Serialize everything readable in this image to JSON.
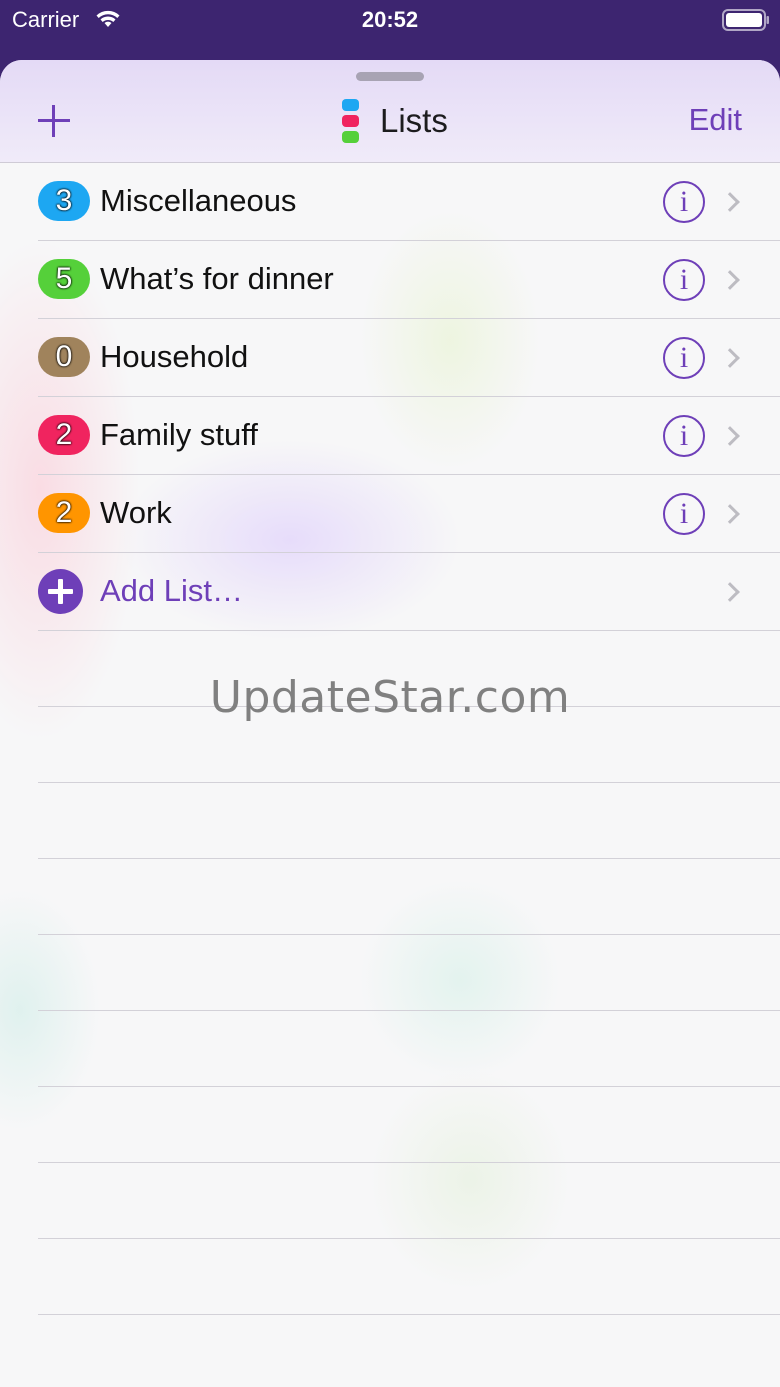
{
  "status_bar": {
    "carrier": "Carrier",
    "time": "20:52",
    "icons": [
      "wifi-icon",
      "battery-icon"
    ]
  },
  "nav": {
    "title": "Lists",
    "edit_label": "Edit",
    "left_icon": "plus-icon",
    "logo_colors": [
      "#1da7f2",
      "#f0245f",
      "#55d03a"
    ]
  },
  "lists": [
    {
      "count": "3",
      "name": "Miscellaneous",
      "color": "#1da7f2"
    },
    {
      "count": "5",
      "name": "What’s for dinner",
      "color": "#55d03a"
    },
    {
      "count": "0",
      "name": "Household",
      "color": "#a0835c"
    },
    {
      "count": "2",
      "name": "Family stuff",
      "color": "#f0245f"
    },
    {
      "count": "2",
      "name": "Work",
      "color": "#ff9500"
    }
  ],
  "add_list": {
    "label": "Add List…"
  },
  "watermark": "UpdateStar.com",
  "colors": {
    "accent": "#6e3fb8",
    "header_bg": "#3d2570"
  }
}
